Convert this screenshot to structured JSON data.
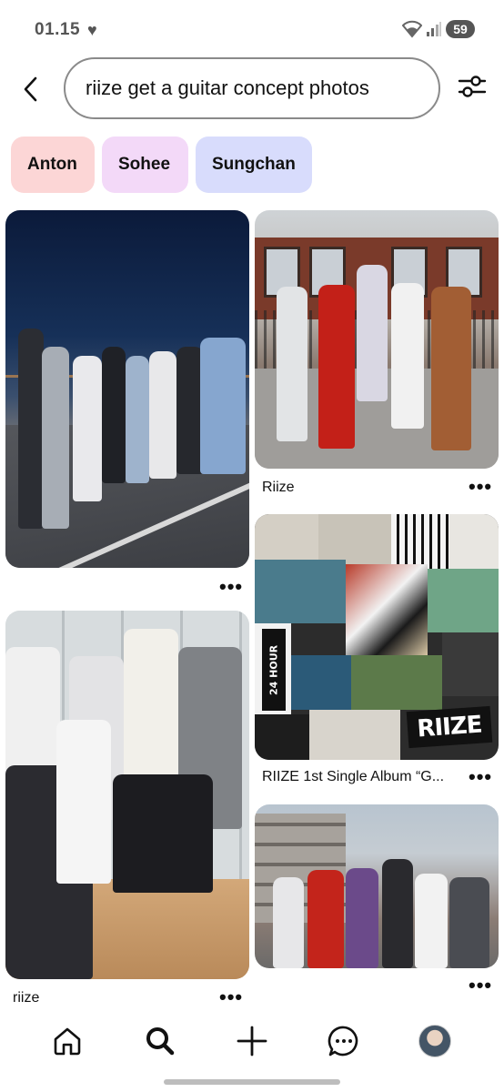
{
  "status_bar": {
    "time": "01.15",
    "heart_icon": "heart-icon",
    "battery": "59"
  },
  "search": {
    "query": "riize get a guitar concept photos",
    "back_icon": "chevron-left-icon",
    "filter_icon": "sliders-icon"
  },
  "chips": [
    {
      "label": "Anton",
      "color": "#fcd6d6"
    },
    {
      "label": "Sohee",
      "color": "#f3d9f8"
    },
    {
      "label": "Sungchan",
      "color": "#d8dcfc"
    }
  ],
  "pins": [
    {
      "label": ""
    },
    {
      "label": "Riize"
    },
    {
      "label": "RIIZE 1st Single Album “G..."
    },
    {
      "label": "riize"
    },
    {
      "label": ""
    }
  ],
  "collage": {
    "logo_text": "RIIZE",
    "sticker_text": "24 HOUR"
  },
  "nav": {
    "items": [
      "home-icon",
      "search-icon",
      "plus-icon",
      "messages-icon",
      "profile-avatar"
    ]
  }
}
